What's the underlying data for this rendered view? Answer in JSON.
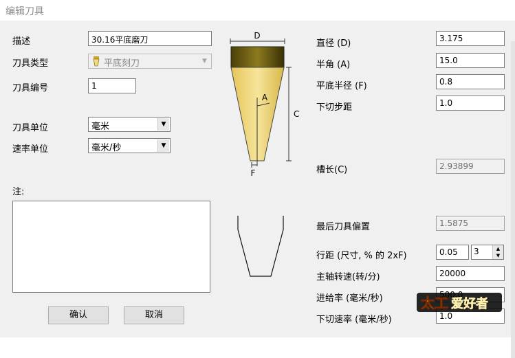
{
  "window": {
    "title": "编辑刀具"
  },
  "left": {
    "desc_label": "描述",
    "desc_value": "30.16平底磨刀",
    "tool_type_label": "刀具类型",
    "tool_type_value": "平底刻刀",
    "tool_number_label": "刀具编号",
    "tool_number_value": "1",
    "tool_unit_label": "刀具单位",
    "tool_unit_value": "毫米",
    "rate_unit_label": "速率单位",
    "rate_unit_value": "毫米/秒",
    "notes_label": "注:"
  },
  "diagram": {
    "label_d": "D",
    "label_a": "A",
    "label_c": "C",
    "label_f": "F",
    "tool_colors": {
      "top": "#6b5c10",
      "body": "#f2dc74",
      "outline": "#333333"
    }
  },
  "right": {
    "diameter_label": "直径 (D)",
    "diameter_value": "3.175",
    "half_angle_label": "半角 (A)",
    "half_angle_value": "15.0",
    "flat_radius_label": "平底半径 (F)",
    "flat_radius_value": "0.8",
    "stepdown_label": "下切步距",
    "stepdown_value": "1.0",
    "flute_length_label": "槽长(C)",
    "flute_length_value": "2.93899",
    "final_offset_label": "最后刀具偏置",
    "final_offset_value": "1.5875",
    "stepover_label": "行距 (尺寸, % 的 2xF)",
    "stepover_value": "0.05",
    "stepover_spin_value": "3",
    "spindle_label": "主轴转速(转/分)",
    "spindle_value": "20000",
    "feed_label": "进给率 (毫米/秒)",
    "feed_value": "500.0",
    "plunge_label": "下切速率 (毫米/秒)",
    "plunge_value": "1.0"
  },
  "buttons": {
    "ok": "确认",
    "cancel": "取消"
  },
  "watermark": {
    "text": "太工爱好者"
  }
}
